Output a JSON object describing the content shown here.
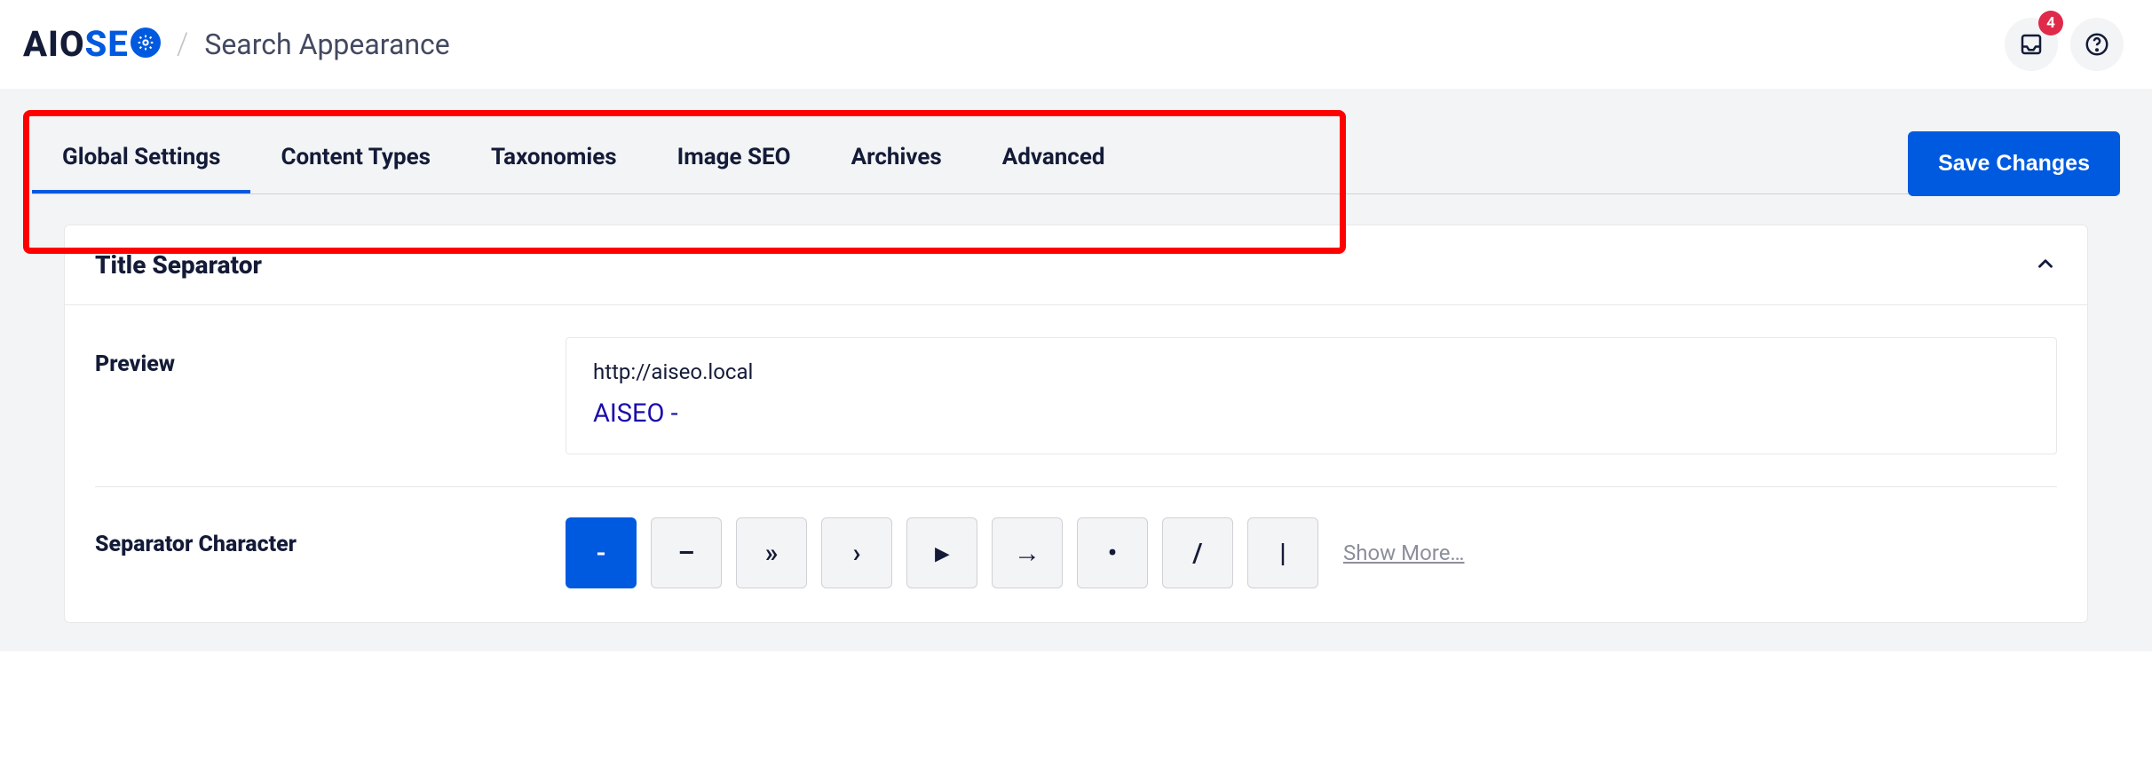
{
  "header": {
    "brand_aio": "AIO",
    "brand_se": "SE",
    "page_title": "Search Appearance",
    "notifications_count": "4"
  },
  "tabs": [
    {
      "label": "Global Settings",
      "active": true
    },
    {
      "label": "Content Types",
      "active": false
    },
    {
      "label": "Taxonomies",
      "active": false
    },
    {
      "label": "Image SEO",
      "active": false
    },
    {
      "label": "Archives",
      "active": false
    },
    {
      "label": "Advanced",
      "active": false
    }
  ],
  "save_button_label": "Save Changes",
  "panel": {
    "title": "Title Separator",
    "preview_label": "Preview",
    "preview_url": "http://aiseo.local",
    "preview_title": "AISEO -",
    "separator_label": "Separator Character",
    "show_more_label": "Show More…"
  },
  "separators": [
    {
      "glyph": "-",
      "name": "dash",
      "selected": true
    },
    {
      "glyph": "–",
      "name": "ndash",
      "selected": false
    },
    {
      "glyph": "»",
      "name": "raquo",
      "selected": false
    },
    {
      "glyph": "›",
      "name": "rsaquo",
      "selected": false
    },
    {
      "glyph": "▸",
      "name": "triangle",
      "selected": false
    },
    {
      "glyph": "→",
      "name": "arrow",
      "selected": false
    },
    {
      "glyph": "•",
      "name": "bullet",
      "selected": false
    },
    {
      "glyph": "/",
      "name": "slash",
      "selected": false
    },
    {
      "glyph": "|",
      "name": "pipe",
      "selected": false
    }
  ]
}
